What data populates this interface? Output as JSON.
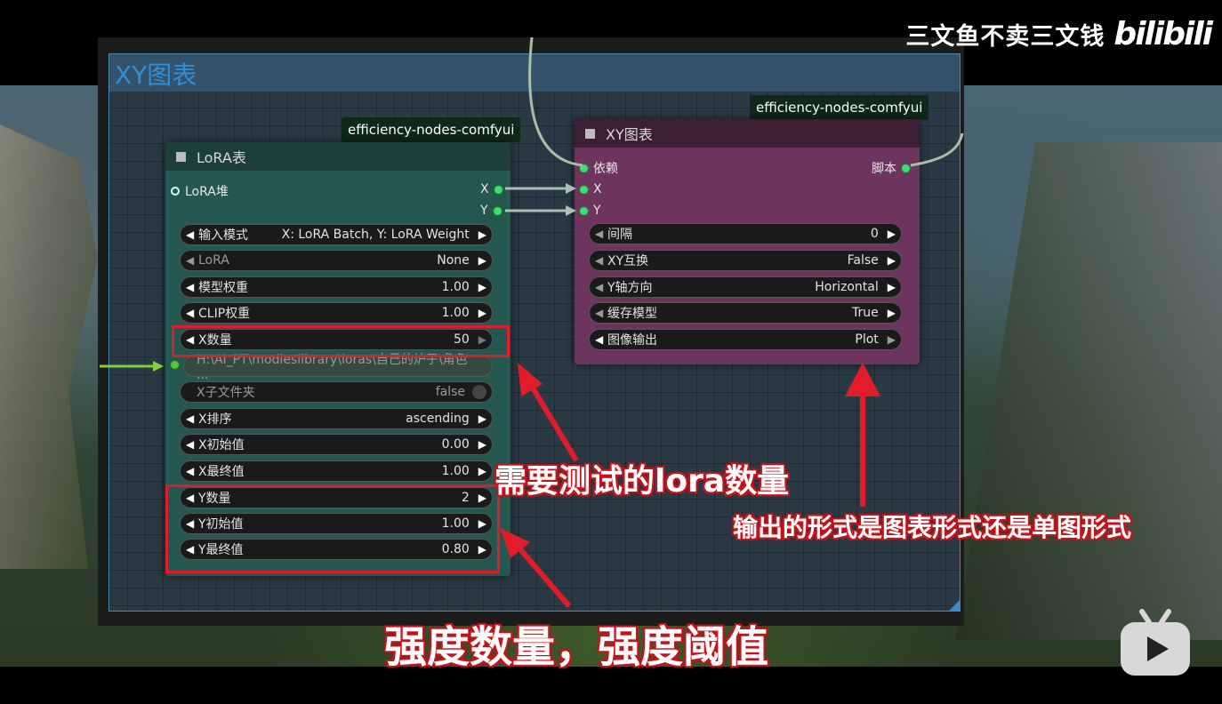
{
  "watermark": {
    "author": "三文鱼不卖三文钱",
    "logo": "bilibili"
  },
  "group": {
    "title": "XY图表"
  },
  "lora_node": {
    "source": "efficiency-nodes-comfyui",
    "title": "LoRA表",
    "input_slot": "LoRA堆",
    "outputs": [
      "X",
      "Y"
    ],
    "widgets": [
      {
        "label": "输入模式",
        "value": "X: LoRA Batch, Y: LoRA Weight"
      },
      {
        "label": "LoRA",
        "value": "None"
      },
      {
        "label": "模型权重",
        "value": "1.00"
      },
      {
        "label": "CLIP权重",
        "value": "1.00"
      },
      {
        "label": "X数量",
        "value": "50"
      },
      {
        "label": "",
        "value": "H:\\AI_PT\\modleslibrary\\loras\\自己的炉子\\角色 ..."
      },
      {
        "label": "X子文件夹",
        "value": "false"
      },
      {
        "label": "X排序",
        "value": "ascending"
      },
      {
        "label": "X初始值",
        "value": "0.00"
      },
      {
        "label": "X最终值",
        "value": "1.00"
      },
      {
        "label": "Y数量",
        "value": "2"
      },
      {
        "label": "Y初始值",
        "value": "1.00"
      },
      {
        "label": "Y最终值",
        "value": "0.80"
      }
    ]
  },
  "xy_node": {
    "source": "efficiency-nodes-comfyui",
    "title": "XY图表",
    "inputs": [
      "依赖",
      "X",
      "Y"
    ],
    "output": "脚本",
    "widgets": [
      {
        "label": "间隔",
        "value": "0"
      },
      {
        "label": "XY互换",
        "value": "False"
      },
      {
        "label": "Y轴方向",
        "value": "Horizontal"
      },
      {
        "label": "缓存模型",
        "value": "True"
      },
      {
        "label": "图像输出",
        "value": "Plot"
      }
    ]
  },
  "annotations": {
    "lora_count": "需要测试的lora数量",
    "output_form": "输出的形式是图表形式还是单图形式",
    "strength": "强度数量，强度阈值"
  },
  "colors": {
    "highlight": "#e21d2b",
    "lora_node": "#24574f",
    "xy_node": "#6d355e",
    "slot": "#38e070"
  }
}
